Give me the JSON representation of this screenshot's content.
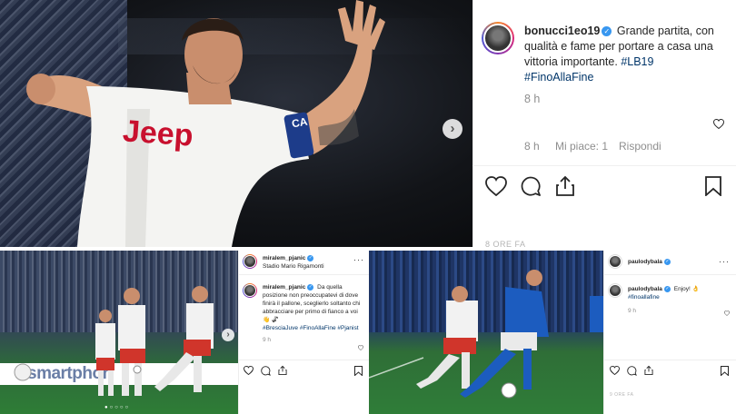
{
  "top_post": {
    "username": "bonucci1eo19",
    "caption_text": "Grande partita, con qualità e fame per portare a casa una vittoria importante.",
    "hashtags": [
      "#LB19",
      "#FinoAllaFine"
    ],
    "time_ago": "8 h",
    "reply_time": "8 h",
    "likes_label": "Mi piace: 1",
    "reply_label": "Rispondi",
    "faded_footer": "8 ORE FA",
    "jersey_brand": "Jeep",
    "armband": "CA"
  },
  "bottom_left_post": {
    "username": "miralem_pjanic",
    "location": "Stadio Mario Rigamonti",
    "comment_user": "miralem_pjanic",
    "comment_text": "Da quella posizione non preoccupatevi di dove finirà il pallone, sceglierlo soltanto chi abbracciare per primo di fianco a voi",
    "emojis": "👋 🦨",
    "hashtags": "#BresciaJuve #FinoAllaFine #Pjanist",
    "time_ago": "9 h",
    "ad_text": "smartphon"
  },
  "bottom_right_post": {
    "username": "paulodybala",
    "comment_user": "paulodybala",
    "comment_text": "Enjoy! 👌",
    "hashtag": "#finoallafine",
    "time_ago": "9 h",
    "faded_footer": "9 ORE FA"
  },
  "colors": {
    "instagram_text": "#262626",
    "hashtag_blue": "#003569",
    "grey": "#8e8e8e",
    "verified_blue": "#3897f0"
  }
}
